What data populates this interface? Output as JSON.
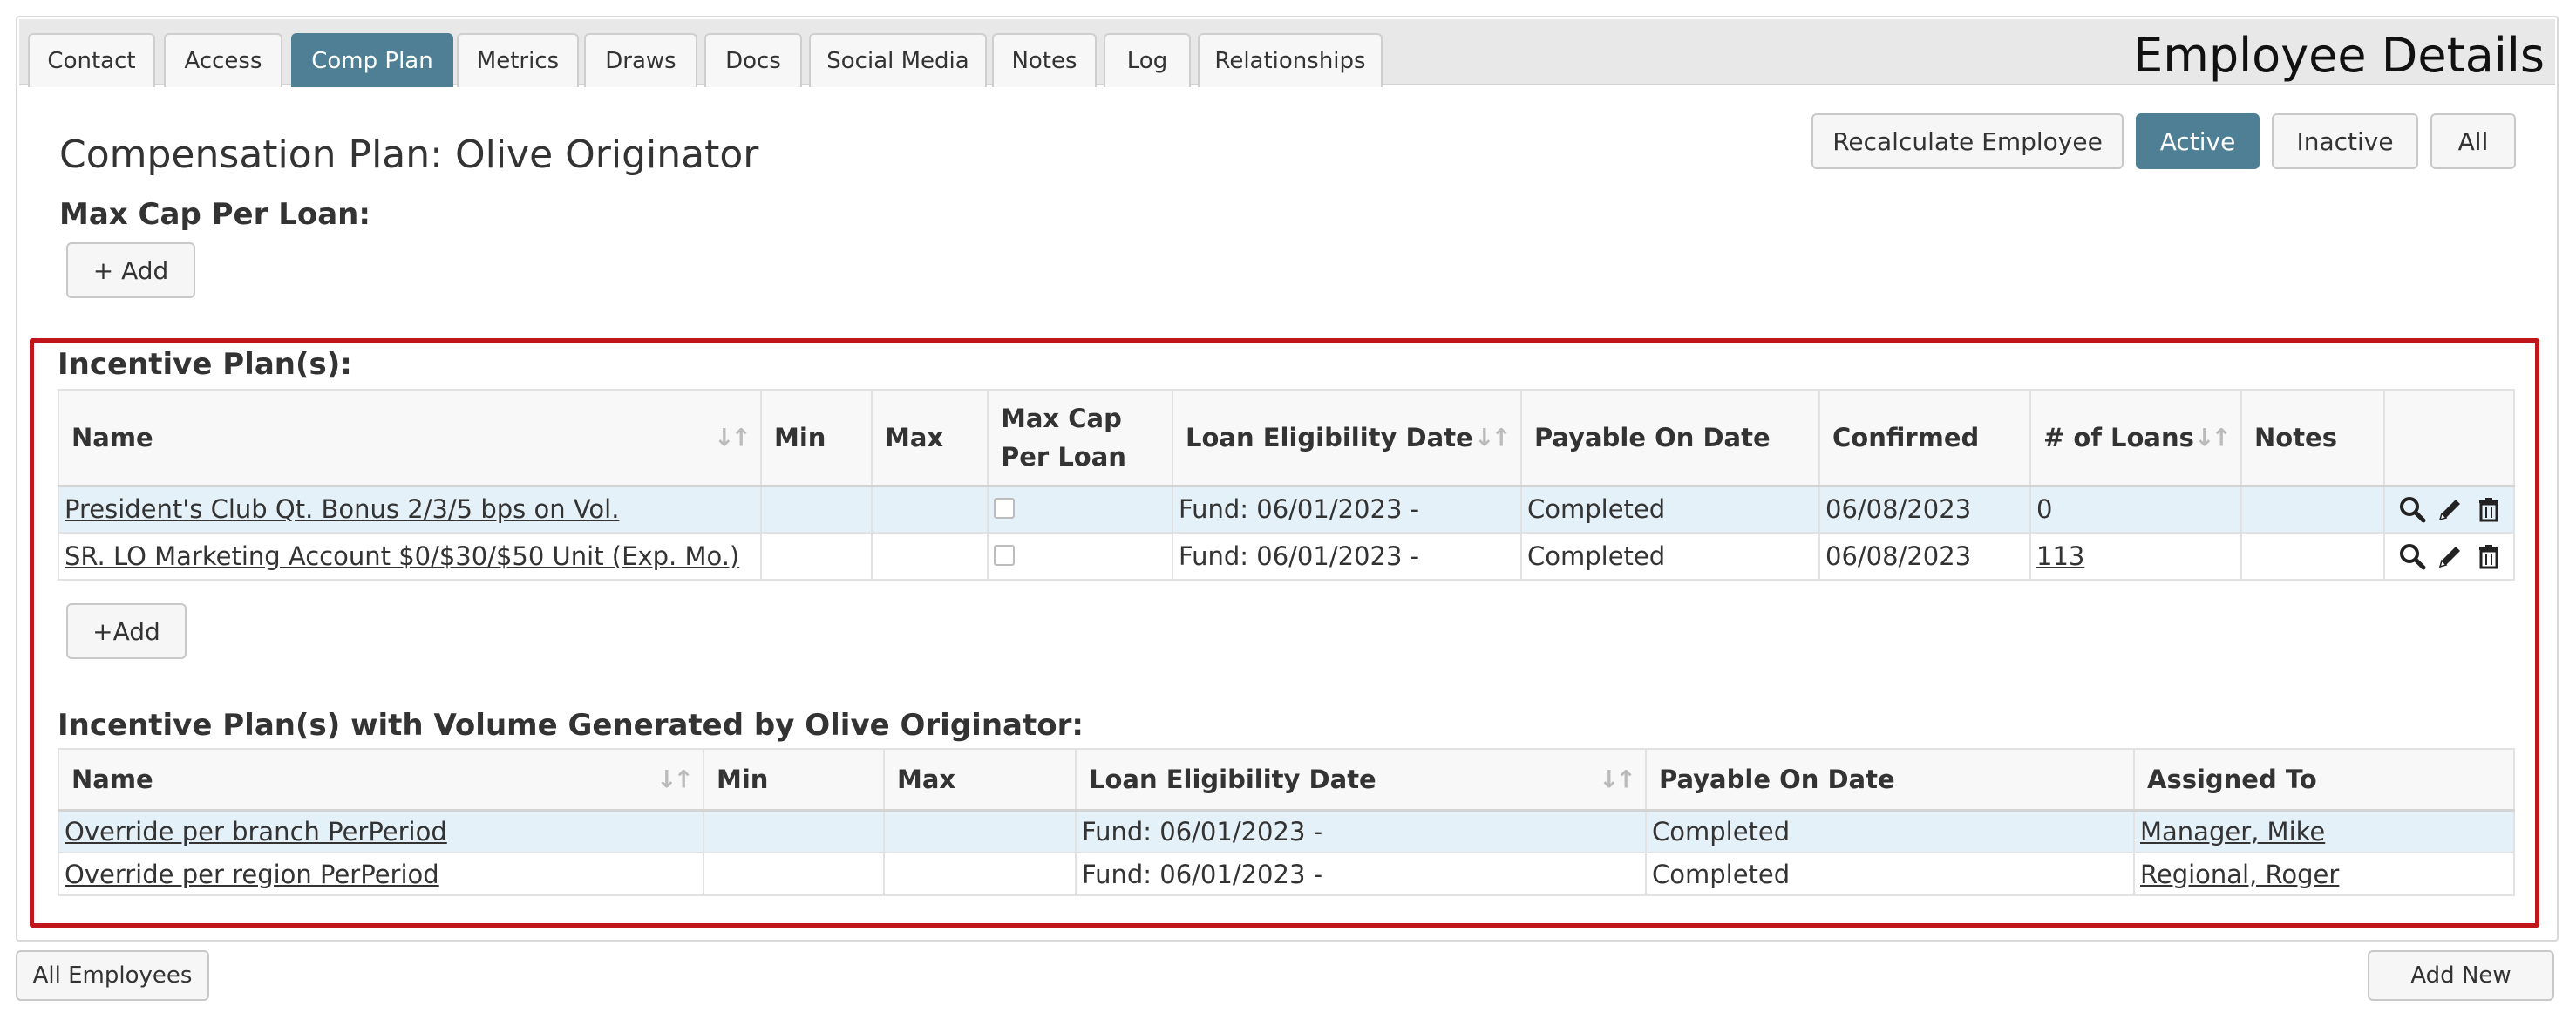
{
  "tabs": [
    {
      "label": "Contact",
      "active": false
    },
    {
      "label": "Access",
      "active": false
    },
    {
      "label": "Comp Plan",
      "active": true
    },
    {
      "label": "Metrics",
      "active": false
    },
    {
      "label": "Draws",
      "active": false
    },
    {
      "label": "Docs",
      "active": false
    },
    {
      "label": "Social Media",
      "active": false
    },
    {
      "label": "Notes",
      "active": false
    },
    {
      "label": "Log",
      "active": false
    },
    {
      "label": "Relationships",
      "active": false
    }
  ],
  "page_heading": "Employee Details",
  "plan_title": "Compensation Plan: Olive Originator",
  "header_buttons": {
    "recalculate": "Recalculate Employee",
    "active": "Active",
    "inactive": "Inactive",
    "all": "All"
  },
  "max_cap": {
    "label": "Max Cap Per Loan:",
    "add_button": "+ Add"
  },
  "incentive_plans": {
    "label": "Incentive Plan(s):",
    "columns": [
      "Name",
      "Min",
      "Max",
      "Max Cap\nPer Loan",
      "Loan Eligibility Date",
      "Payable On Date",
      "Confirmed",
      "# of Loans",
      "Notes"
    ],
    "rows": [
      {
        "name": "President's Club Qt. Bonus 2/3/5 bps on Vol.",
        "min": "",
        "max": "",
        "max_cap_checked": false,
        "eligibility": "Fund: 06/01/2023 -",
        "payable": "Completed",
        "confirmed": "06/08/2023",
        "loans": "0",
        "loans_link": false,
        "notes": ""
      },
      {
        "name": "SR. LO Marketing Account $0/$30/$50 Unit (Exp. Mo.)",
        "min": "",
        "max": "",
        "max_cap_checked": false,
        "eligibility": "Fund: 06/01/2023 -",
        "payable": "Completed",
        "confirmed": "06/08/2023",
        "loans": "113",
        "loans_link": true,
        "notes": ""
      }
    ],
    "add_button": "+Add"
  },
  "volume_plans": {
    "label": "Incentive Plan(s) with Volume Generated by Olive Originator:",
    "columns": [
      "Name",
      "Min",
      "Max",
      "Loan Eligibility Date",
      "Payable On Date",
      "Assigned To"
    ],
    "rows": [
      {
        "name": "Override per branch PerPeriod",
        "min": "",
        "max": "",
        "eligibility": "Fund: 06/01/2023 -",
        "payable": "Completed",
        "assigned": "Manager, Mike"
      },
      {
        "name": "Override per region PerPeriod",
        "min": "",
        "max": "",
        "eligibility": "Fund: 06/01/2023 -",
        "payable": "Completed",
        "assigned": "Regional, Roger"
      }
    ]
  },
  "footer": {
    "all_employees": "All Employees",
    "add_new": "Add New"
  },
  "icons": {
    "sort": "sort-icon",
    "view": "search-icon",
    "edit": "pencil-icon",
    "delete": "trash-icon"
  },
  "colors": {
    "accent": "#4e7f94",
    "highlight_border": "#c0161b",
    "odd_row": "#e5f1f8"
  }
}
